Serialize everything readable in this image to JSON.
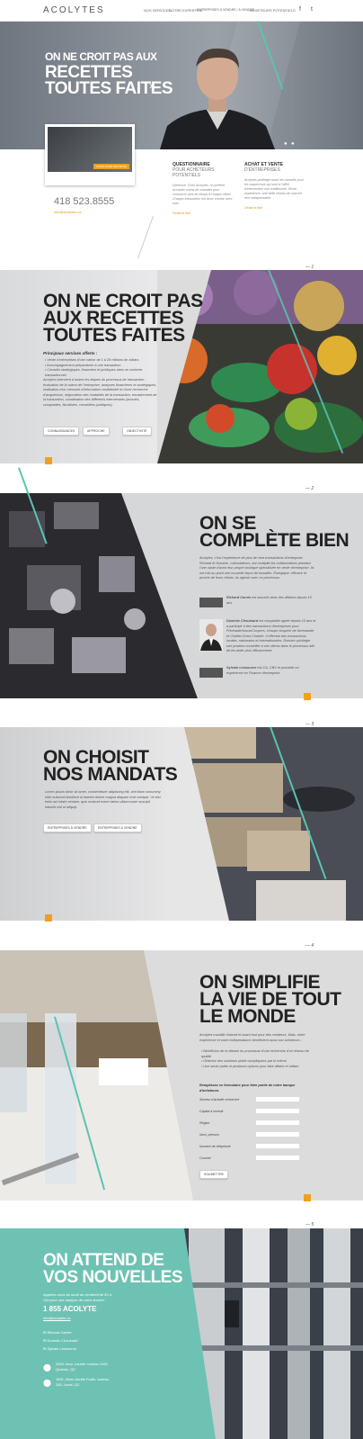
{
  "nav": {
    "logo": "ACOLYTES",
    "items": [
      "NOS SERVICES",
      "NOTRE EXPERTISE",
      "ENTREPRISES À VENDRE / À VENDRE",
      "ACHETEURS POTENTIELS"
    ],
    "social": [
      "f",
      "t"
    ]
  },
  "hero": {
    "title_line1": "ON NE CROIT PAS AUX",
    "title_line2": "RECETTES",
    "title_line3": "TOUTES FAITES",
    "card_button": "CONSULTER PAR BOSS",
    "phone": "418 523.8555",
    "email": "info@acolytes.ca"
  },
  "columns": [
    {
      "title": "QUESTIONNAIRE",
      "subtitle": "POUR ACHETEURS POTENTIELS",
      "text": "Intéressé. Chez Acolytes, on préfère accepter moins de mandats pour consacrer plus de temps à chaque client. Chaque transaction est donc choisie avec soin.",
      "link": "Détail et tarif"
    },
    {
      "title": "ACHAT ET VENTE",
      "subtitle": "D'ENTREPRISES",
      "text": "Acolytes privilégie aussi les conseils pour les acquéreurs qui sont à l'affût d'intervention non traditionnel. Riche expérience, une belle réseau de marché réel indispensable.",
      "link": "Détail et tarif"
    }
  ],
  "s1": {
    "num": "— 1",
    "title_line1": "ON NE CROIT PAS",
    "title_line2": "AUX RECETTES",
    "title_line3": "TOUTES FAITES",
    "subtitle": "Principaux services offerts :",
    "bullets": [
      "Vente d'entreprises d'une valeur de 1 à 25 millions de dollars",
      "Accompagnement préparatoire à une transaction",
      "Conseils stratégiques, financiers et juridiques dans un contexte transactionnel"
    ],
    "paragraph": "Acolytes intervient à toutes les étapes du processus de transaction : évaluation de la valeur de l'entreprise, analyses financières et stratégiques, réalisation d'un mémoire d'information confidentiel et d'une recherche d'acquéreurs, négociation des modalités de la transaction, encadrement de la transaction, coordination des différents intervenants (avocats, comptables, fiscalistes, conseillers juridiques).",
    "buttons": [
      "CONNAISSANCES",
      "APPROCHE",
      "OBJECTIVITÉ"
    ]
  },
  "s2": {
    "num": "— 2",
    "title_line1": "ON SE",
    "title_line2": "COMPLÈTE BIEN",
    "paragraph": "Acolytes, c'est l'expérience de plus de vent transactions d'entreprise. Richard et Dominic, cofondateurs, ont multiplié les collaborations pendant l'une vaste d'avoir leur propre boutique spécialisée en vente d'entreprise. Ils ont mis au point une nouvelle façon de travailler. Énergique, efficace et proche de leurs clients, ils agiront avec ce processus.",
    "people": [
      {
        "name": "Richard Carrée",
        "text": "est associé dans des affaires depuis 15 ans."
      },
      {
        "name": "Dominic Chouinard",
        "text": "est comptable agréé depuis 10 ans et a participé à des transactions d'entreprises pour PricewaterhouseCoopers, Groupe Acquérir de Normandie et Chalets Ernst Chartier. Il effectue des transactions locales, nationales et internationales. Dominic privilégie une position conseiller à ses clients dans le processus afin de les aider plus efficacement."
      },
      {
        "name": "Sylvain Lessource",
        "text": "est CA, CBV et possède un expérience en Finance d'entreprise."
      }
    ]
  },
  "s3": {
    "num": "— 3",
    "title_line1": "ON CHOISIT",
    "title_line2": "NOS MANDATS",
    "paragraph": "Lorem ipsum dolor sit amet, consectetuer adipiscing elit, sed diam nonummy nibh euismod tincidunt ut laoreet dolore magna aliquam erat volutpat. Ut wisi enim ad minim veniam, quis nostrud exerci tation ullamcorper suscipit lobortis nisl ut aliquip.",
    "buttons": [
      "ENTREPRISES À VENDRE",
      "ENTREPRISES À VENDRE"
    ]
  },
  "s4": {
    "num": "— 4",
    "title_line1": "ON SIMPLIFIE",
    "title_line2": "LA VIE DE TOUT",
    "title_line3": "LE MONDE",
    "paragraph": "Acolytes travaille d'abord et avant tout pour des vendeurs. Mais, notre expérience et notre indépendance bénéficient aussi aux acheteurs :",
    "bullets": [
      "Bénéficiez de la vitesse du processus d'une recherche d'un réseau de qualité",
      "Obtenez des solutions plutôt compliquées par le même",
      "Une seule partie et plusieurs options pour faire affaire et utiliser"
    ],
    "form_title": "Remplissez ce formulaire pour faire partie de notre banque d'acheteurs.",
    "fields": [
      "Secteur d'activité recherché",
      "Capital à investir",
      "Région",
      "Nom, prénom",
      "Numéro de téléphone",
      "Courriel"
    ],
    "submit": "SOUMETTRE"
  },
  "s5": {
    "num": "— 5",
    "title_line1": "ON ATTEND DE",
    "title_line2": "VOS NOUVELLES",
    "intro": "Appelez-nous du lundi au vendredi de 8h à 19h pour une analyse de votre dossier :",
    "phone": "1 855 ACOLYTE",
    "email": "info@acolytes.ca",
    "contacts": [
      "Richard Carrée",
      "Dominic Chouinard",
      "Sylvain Lessource"
    ],
    "addresses": [
      "2600, boul. Laurier, bureau 1100, Québec, QC",
      "1591, Marc-Aurèle Fortin, bureau 150, Laval, QC"
    ]
  }
}
